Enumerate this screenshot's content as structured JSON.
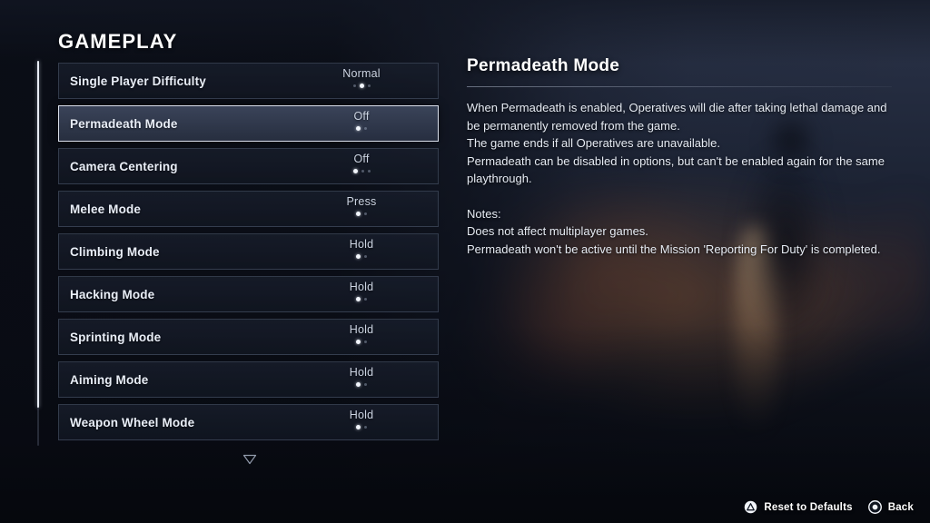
{
  "page": {
    "title": "GAMEPLAY"
  },
  "settings": {
    "items": [
      {
        "label": "Single Player Difficulty",
        "value": "Normal",
        "dots": 3,
        "active_index": 1,
        "selected": false
      },
      {
        "label": "Permadeath Mode",
        "value": "Off",
        "dots": 2,
        "active_index": 0,
        "selected": true
      },
      {
        "label": "Camera Centering",
        "value": "Off",
        "dots": 3,
        "active_index": 0,
        "selected": false
      },
      {
        "label": "Melee Mode",
        "value": "Press",
        "dots": 2,
        "active_index": 0,
        "selected": false
      },
      {
        "label": "Climbing Mode",
        "value": "Hold",
        "dots": 2,
        "active_index": 0,
        "selected": false
      },
      {
        "label": "Hacking Mode",
        "value": "Hold",
        "dots": 2,
        "active_index": 0,
        "selected": false
      },
      {
        "label": "Sprinting Mode",
        "value": "Hold",
        "dots": 2,
        "active_index": 0,
        "selected": false
      },
      {
        "label": "Aiming Mode",
        "value": "Hold",
        "dots": 2,
        "active_index": 0,
        "selected": false
      },
      {
        "label": "Weapon Wheel Mode",
        "value": "Hold",
        "dots": 2,
        "active_index": 0,
        "selected": false
      }
    ],
    "scroll_down_icon": "chevron-down-triangle-icon"
  },
  "detail": {
    "title": "Permadeath Mode",
    "body": "When Permadeath is enabled, Operatives will die after taking lethal damage and be permanently removed from the game.\nThe game ends if all Operatives are unavailable.\nPermadeath can be disabled in options, but can't be enabled again for the same playthrough.",
    "notes": "Notes:\nDoes not affect multiplayer games.\nPermadeath won't be active until the Mission 'Reporting For Duty' is completed."
  },
  "footer": {
    "prompts": [
      {
        "icon": "playstation-triangle-button-icon",
        "label": "Reset to Defaults"
      },
      {
        "icon": "playstation-circle-button-icon",
        "label": "Back"
      }
    ]
  },
  "colors": {
    "accent_white": "#ffffff",
    "text_primary": "#e9eef7",
    "text_value": "#ccd4e2",
    "row_border": "#7e8eaa",
    "selected_border": "#e8eef8",
    "background_dark": "#0a0d16",
    "background_warm": "#c4763a"
  }
}
